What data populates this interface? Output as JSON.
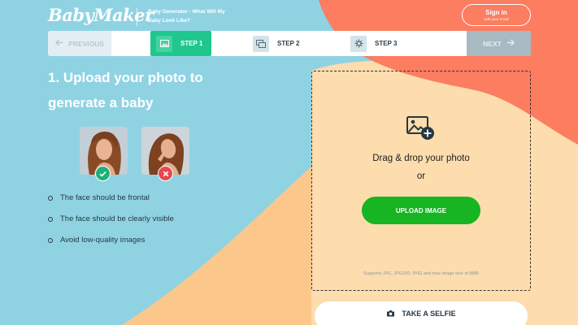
{
  "header": {
    "logo_text": "BabyMaker",
    "tagline": "Baby Generator - What Will My Baby Look Like?",
    "signin_label": "Sign in",
    "signin_sub": "with your email"
  },
  "steps": {
    "previous_label": "PREVIOUS",
    "next_label": "NEXT",
    "step1_label": "STEP 1",
    "step2_label": "STEP 2",
    "step3_label": "STEP 3",
    "active_step": 1
  },
  "main": {
    "heading": "1. Upload your photo to generate a baby",
    "tips": [
      "The face should be frontal",
      "The face should be clearly visible",
      "Avoid low-quality images"
    ]
  },
  "upload": {
    "drop_text": "Drag & drop your photo",
    "or_text": "or",
    "button_label": "UPLOAD IMAGE",
    "supports_text": "Supports JPG, JPG200, PNG and max image size of 8MB",
    "selfie_label": "TAKE A SELFIE"
  },
  "colors": {
    "sky_blue": "#8fd3e3",
    "peach": "#fddcae",
    "orange": "#fcc78b",
    "coral": "#fc7d60",
    "step_active": "#1fc78e",
    "upload_green": "#16b521",
    "ok_badge": "#1fb07a",
    "bad_badge": "#e7474e"
  },
  "icons": {
    "step1": "image-icon",
    "step2": "images-icon",
    "step3": "gear-icon",
    "upload": "add-image-icon",
    "selfie": "camera-icon"
  }
}
